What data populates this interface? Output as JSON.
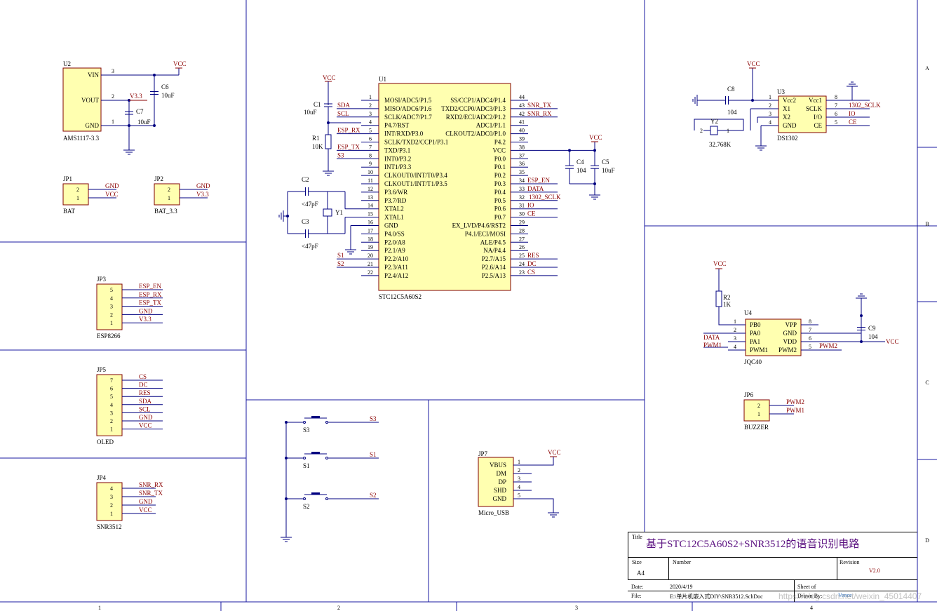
{
  "title_block": {
    "title_label": "Title",
    "title": "基于STC12C5A60S2+SNR3512的语音识别电路",
    "size_label": "Size",
    "size": "A4",
    "number_label": "Number",
    "revision_label": "Revision",
    "revision": "V2.0",
    "date_label": "Date:",
    "date": "2020/4/19",
    "sheet_label": "Sheet of",
    "file_label": "File:",
    "file": "E:\\单片机嵌入式DIY\\SNR3512.SchDoc",
    "drawn_label": "Drawn By:",
    "drawn_by": "Vence"
  },
  "border": {
    "rows": [
      "A",
      "B",
      "C",
      "D"
    ],
    "cols": [
      "1",
      "2",
      "3",
      "4"
    ]
  },
  "colors": {
    "wire": "#000080",
    "net": "#8a0000",
    "body": "#ffffb0",
    "border": "#1a1aa0"
  },
  "u2": {
    "des": "U2",
    "name": "AMS1117-3.3",
    "pins": [
      "VIN",
      "VOUT",
      "GND"
    ],
    "nums": [
      "3",
      "2",
      "1"
    ]
  },
  "u2nets": {
    "vcc": "VCC",
    "v33": "V3.3",
    "c6": "C6",
    "c6v": "10uF",
    "c7": "C7",
    "c7v": "10uF"
  },
  "jp1": {
    "des": "JP1",
    "name": "BAT",
    "nets": [
      "GND",
      "VCC"
    ],
    "nums": [
      "2",
      "1"
    ]
  },
  "jp2": {
    "des": "JP2",
    "name": "BAT_3.3",
    "nets": [
      "GND",
      "V3.3"
    ],
    "nums": [
      "2",
      "1"
    ]
  },
  "jp3": {
    "des": "JP3",
    "name": "ESP8266",
    "nets": [
      "ESP_EN",
      "ESP_RX",
      "ESP_TX",
      "GND",
      "V3.3"
    ],
    "nums": [
      "5",
      "4",
      "3",
      "2",
      "1"
    ]
  },
  "jp5": {
    "des": "JP5",
    "name": "OLED",
    "nets": [
      "CS",
      "DC",
      "RES",
      "SDA",
      "SCL",
      "GND",
      "VCC"
    ],
    "nums": [
      "7",
      "6",
      "5",
      "4",
      "3",
      "2",
      "1"
    ]
  },
  "jp4": {
    "des": "JP4",
    "name": "SNR3512",
    "nets": [
      "SNR_RX",
      "SNR_TX",
      "GND",
      "VCC"
    ],
    "nums": [
      "4",
      "3",
      "2",
      "1"
    ]
  },
  "u1": {
    "des": "U1",
    "name": "STC12C5A60S2",
    "left": [
      "MOSI/ADC5/P1.5",
      "MISO/ADC6/P1.6",
      "SCLK/ADC7/P1.7",
      "P4.7/RST",
      "INT/RXD/P3.0",
      "SCLK/TXD2/CCP1/P3.1",
      "TXD/P3.1",
      "INT0/P3.2",
      "INT1/P3.3",
      "CLKOUT0/INT/T0/P3.4",
      "CLKOUT1/INT/T1/P3.5",
      "P3.6/WR",
      "P3.7/RD",
      "XTAL2",
      "XTAL1",
      "GND",
      "P4.0/SS",
      "P2.0/A8",
      "P2.1/A9",
      "P2.2/A10",
      "P2.3/A11",
      "P2.4/A12"
    ],
    "right": [
      "SS/CCP1/ADC4/P1.4",
      "TXD2/CCP0/ADC3/P1.3",
      "RXD2/ECI/ADC2/P1.2",
      "ADC1/P1.1",
      "CLKOUT2/ADC0/P1.0",
      "P4.2",
      "VCC",
      "P0.0",
      "P0.1",
      "P0.2",
      "P0.3",
      "P0.4",
      "P0.5",
      "P0.6",
      "P0.7",
      "EX_LVD/P4.6/RST2",
      "P4.1/ECI/MOSI",
      "ALE/P4.5",
      "NA/P4.4",
      "P2.7/A15",
      "P2.6/A14",
      "P2.5/A13"
    ],
    "lnums": [
      "1",
      "2",
      "3",
      "4",
      "5",
      "6",
      "7",
      "8",
      "9",
      "10",
      "11",
      "12",
      "13",
      "14",
      "15",
      "16",
      "17",
      "18",
      "19",
      "20",
      "21",
      "22"
    ],
    "rnums": [
      "44",
      "43",
      "42",
      "41",
      "40",
      "39",
      "38",
      "37",
      "36",
      "35",
      "34",
      "33",
      "32",
      "31",
      "30",
      "29",
      "28",
      "27",
      "26",
      "25",
      "24",
      "23"
    ]
  },
  "u1nets": {
    "left": [
      "SDA",
      "SCL",
      "ESP_RX",
      "ESP_TX",
      "S3",
      "S1",
      "S2"
    ],
    "right": [
      "SNR_TX",
      "SNR_RX",
      "ESP_EN",
      "DATA",
      "1302_SCLK",
      "IO",
      "CE",
      "RES",
      "DC",
      "CS"
    ],
    "vcc": "VCC",
    "c1": "C1",
    "c1v": "10uF",
    "r1": "R1",
    "r1v": "10K",
    "c2": "C2",
    "c2v": "<47pF",
    "c3": "C3",
    "c3v": "<47pF",
    "y1": "Y1",
    "c4": "C4",
    "c4v": "104",
    "c5": "C5",
    "c5v": "10uF"
  },
  "u3": {
    "des": "U3",
    "name": "DS1302",
    "left": [
      "Vcc2",
      "X1",
      "X2",
      "GND"
    ],
    "right": [
      "Vcc1",
      "SCLK",
      "I/O",
      "CE"
    ],
    "lnums": [
      "1",
      "2",
      "3",
      "4"
    ],
    "rnums": [
      "8",
      "7",
      "6",
      "5"
    ]
  },
  "u3nets": {
    "vcc": "VCC",
    "c8": "C8",
    "c8v": "104",
    "y2": "Y2",
    "y2v": "32.768K",
    "y2pins": [
      "2",
      "1"
    ],
    "right": [
      "1302_SCLK",
      "IO",
      "CE"
    ]
  },
  "u4": {
    "des": "U4",
    "name": "JQC40",
    "left": [
      "PB0",
      "PA0",
      "PA1",
      "PWM1"
    ],
    "right": [
      "VPP",
      "GND",
      "VDD",
      "PWM2"
    ],
    "lnums": [
      "1",
      "2",
      "3",
      "4"
    ],
    "rnums": [
      "8",
      "7",
      "6",
      "5"
    ]
  },
  "u4nets": {
    "vcc": "VCC",
    "vcc2": "VCC",
    "r2": "R2",
    "r2v": "1K",
    "c9": "C9",
    "c9v": "104",
    "data": "DATA",
    "pwm1": "PWM1",
    "pwm2": "PWM2"
  },
  "jp6": {
    "des": "JP6",
    "name": "BUZZER",
    "nets": [
      "PWM2",
      "PWM1"
    ],
    "nums": [
      "2",
      "1"
    ]
  },
  "switches": {
    "labels": [
      "S3",
      "S1",
      "S2"
    ],
    "nets": [
      "S3",
      "S1",
      "S2"
    ]
  },
  "jp7": {
    "des": "JP7",
    "name": "Micro_USB",
    "pins": [
      "VBUS",
      "DM",
      "DP",
      "SHD",
      "GND"
    ],
    "nums": [
      "1",
      "2",
      "3",
      "4",
      "5"
    ],
    "vcc": "VCC"
  },
  "watermark": "https://blog.csdn.net/weixin_45014407"
}
